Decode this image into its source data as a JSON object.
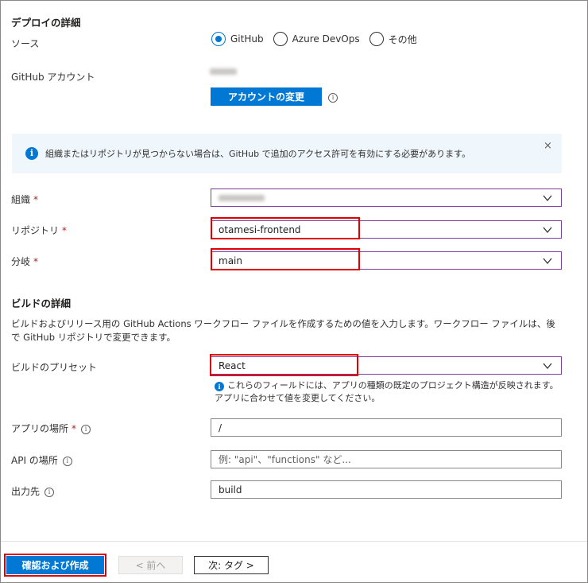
{
  "deploy": {
    "title": "デプロイの詳細",
    "source_label": "ソース",
    "source_options": [
      "GitHub",
      "Azure DevOps",
      "その他"
    ],
    "source_selected": "GitHub",
    "account_label": "GitHub アカウント",
    "change_account_button": "アカウントの変更"
  },
  "banner": {
    "icon": "info-icon",
    "text": "組織またはリポジトリが見つからない場合は、GitHub で追加のアクセス許可を有効にする必要があります。",
    "close": "×"
  },
  "fields": {
    "org_label": "組織",
    "repo_label": "リポジトリ",
    "repo_value": "otamesi-frontend",
    "branch_label": "分岐",
    "branch_value": "main",
    "required_mark": "*"
  },
  "build": {
    "title": "ビルドの詳細",
    "description": "ビルドおよびリリース用の GitHub Actions ワークフロー ファイルを作成するための値を入力します。ワークフロー ファイルは、後で GitHub リポジトリで変更できます。",
    "preset_label": "ビルドのプリセット",
    "preset_value": "React",
    "preset_hint": "これらのフィールドには、アプリの種類の既定のプロジェクト構造が反映されます。アプリに合わせて値を変更してください。",
    "app_location_label": "アプリの場所",
    "app_location_value": "/",
    "api_location_label": "API の場所",
    "api_location_placeholder": "例: \"api\"、\"functions\" など...",
    "output_label": "出力先",
    "output_value": "build"
  },
  "footer": {
    "review_button": "確認および作成",
    "prev_button": "< 前へ",
    "next_button": "次: タグ >"
  },
  "colors": {
    "accent": "#0078d4",
    "highlight": "#e00000",
    "banner_bg": "#eff6fc"
  }
}
